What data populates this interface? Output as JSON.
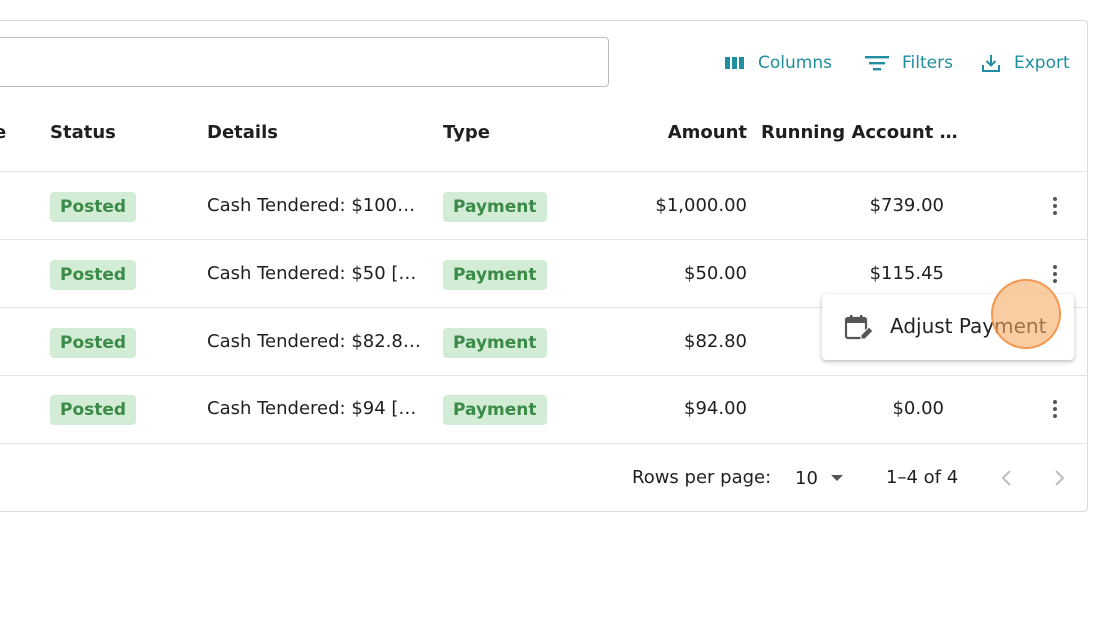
{
  "toolbar": {
    "columns_label": "Columns",
    "filters_label": "Filters",
    "export_label": "Export",
    "accent_color": "#1f8ea0"
  },
  "search": {
    "value": "",
    "placeholder": ""
  },
  "table": {
    "columns": {
      "partial_left": "e",
      "status": "Status",
      "details": "Details",
      "type": "Type",
      "amount": "Amount",
      "running": "Running Account …"
    },
    "rows": [
      {
        "status": "Posted",
        "details": "Cash Tendered: $100…",
        "type": "Payment",
        "amount": "$1,000.00",
        "running": "$739.00"
      },
      {
        "status": "Posted",
        "details": "Cash Tendered: $50 […",
        "type": "Payment",
        "amount": "$50.00",
        "running": "$115.45"
      },
      {
        "status": "Posted",
        "details": "Cash Tendered: $82.8…",
        "type": "Payment",
        "amount": "$82.80",
        "running": ""
      },
      {
        "status": "Posted",
        "details": "Cash Tendered: $94 […",
        "type": "Payment",
        "amount": "$94.00",
        "running": "$0.00"
      }
    ]
  },
  "row_menu": {
    "adjust_payment_label": "Adjust Payment",
    "icon": "calendar-edit-icon"
  },
  "footer": {
    "rows_per_page_label": "Rows per page:",
    "rows_per_page_value": "10",
    "range_label": "1–4 of 4"
  },
  "colors": {
    "chip_bg": "#d3ecd6",
    "chip_text": "#3b8a47"
  }
}
